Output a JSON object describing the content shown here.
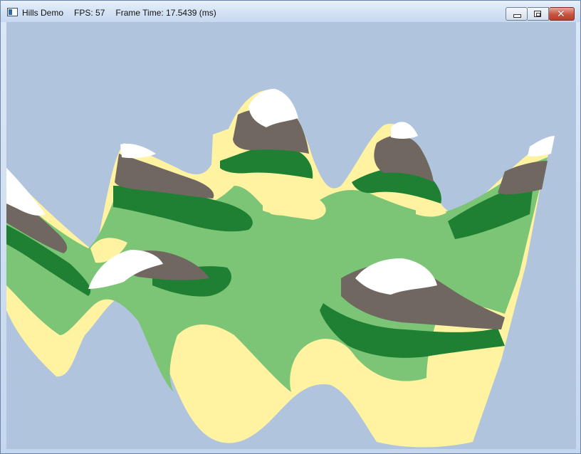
{
  "window": {
    "app_name": "Hills Demo",
    "fps_text": "FPS: 57",
    "frame_time_text": "Frame Time: 17.5439 (ms)"
  },
  "controls": {
    "minimize_icon": "minimize-icon",
    "maximize_icon": "maximize-icon",
    "close_icon": "close-icon",
    "close_glyph": "✕"
  },
  "viewport": {
    "background_color": "#B0C4DE",
    "content": "3D rendered terrain of green hills with snow-capped peaks",
    "colors": {
      "sand": "#FFF2A0",
      "light_green": "#7CC576",
      "dark_green": "#1F8033",
      "brown": "#6F6760",
      "snow": "#FFFFFF"
    }
  }
}
